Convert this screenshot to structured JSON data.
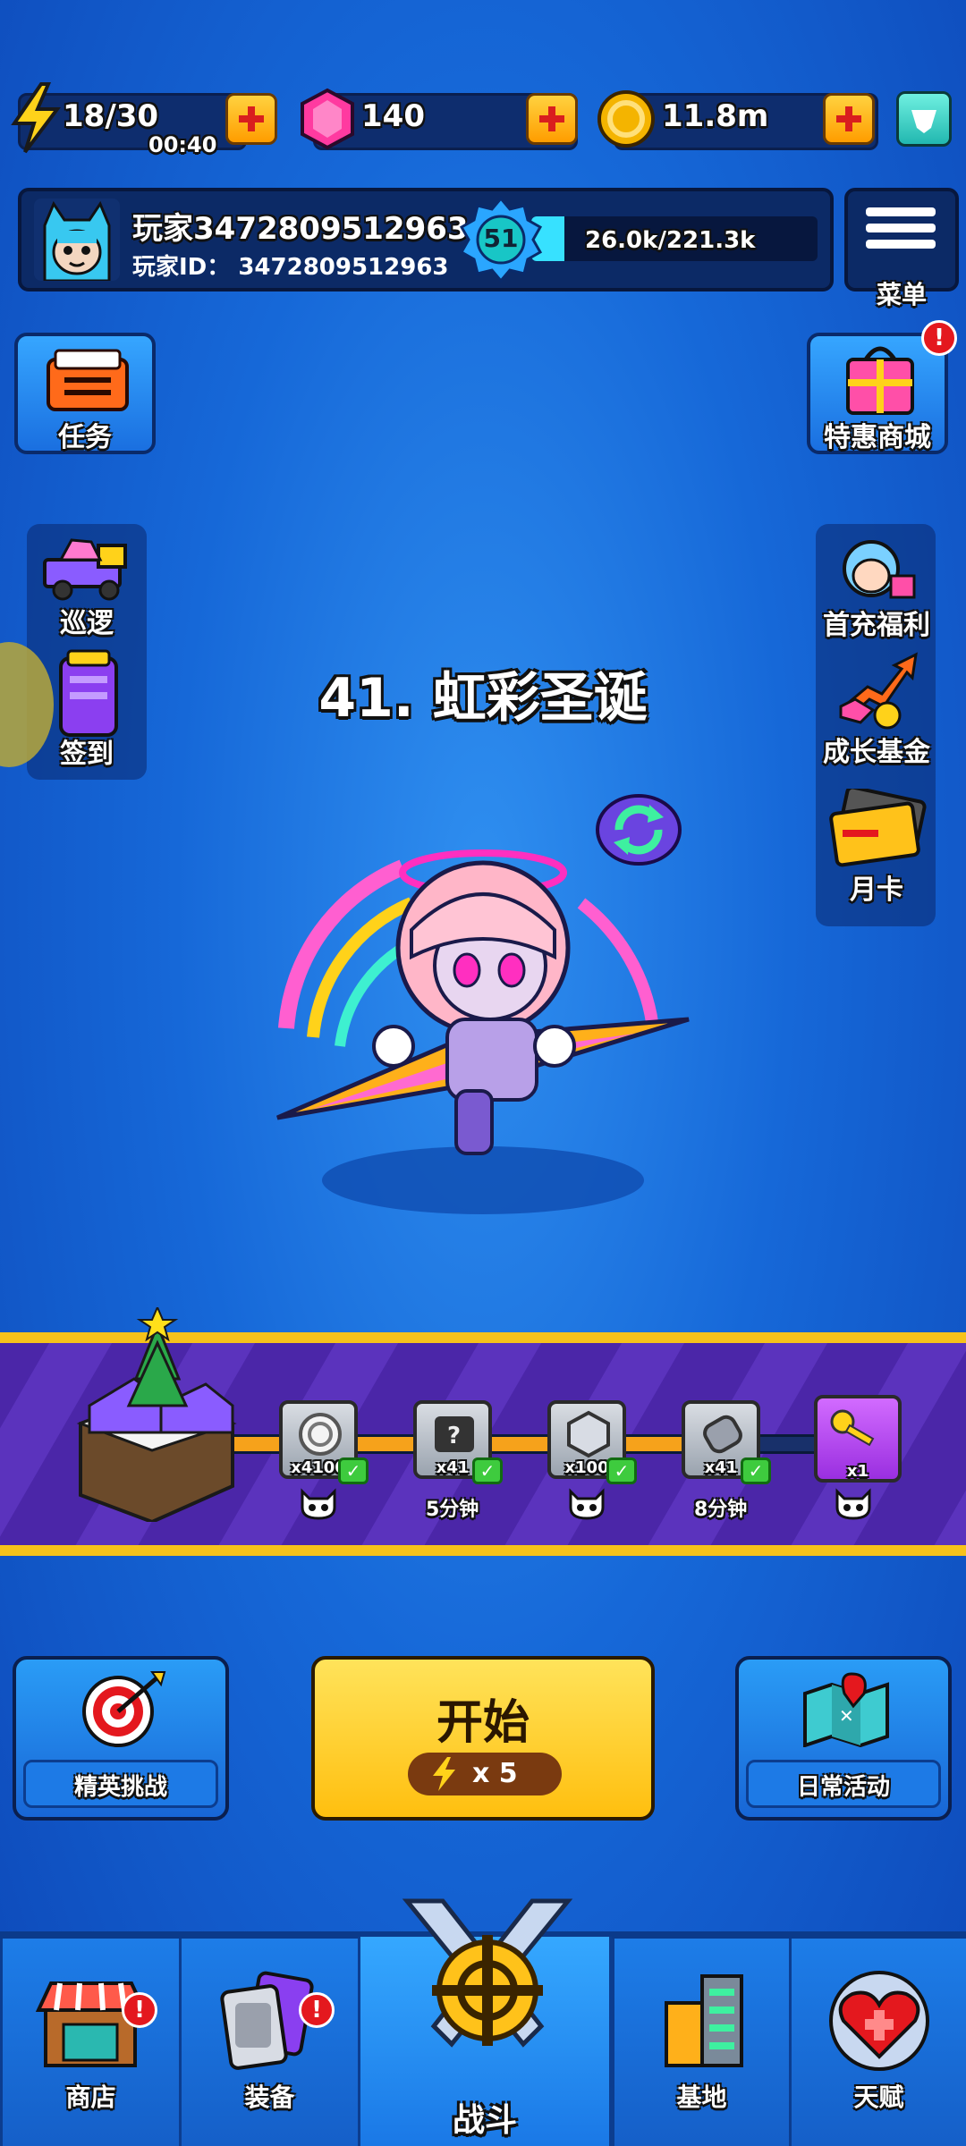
{
  "resources": {
    "energy": "18/30",
    "energy_timer": "00:40",
    "gems": "140",
    "coins": "11.8m"
  },
  "player": {
    "name": "玩家3472809512963",
    "id_label": "玩家ID：",
    "id_value": "3472809512963",
    "level": "51",
    "xp": "26.0k/221.3k",
    "xp_fraction": 0.117
  },
  "menu_label": "菜单",
  "left_buttons": {
    "tasks": "任务",
    "patrol": "巡逻",
    "checkin": "签到"
  },
  "right_buttons": {
    "special_shop": "特惠商城",
    "first_recharge": "首充福利",
    "growth_fund": "成长基金",
    "monthly_card": "月卡"
  },
  "stage": {
    "title": "41. 虹彩圣诞"
  },
  "progress": {
    "nodes": [
      {
        "qty": "x4100",
        "claimed": true,
        "icon": "coin-icon"
      },
      {
        "qty": "x41",
        "claimed": true,
        "icon": "mystery-ticket-icon"
      },
      {
        "qty": "x100",
        "claimed": true,
        "icon": "hexagon-gem-icon"
      },
      {
        "qty": "x41",
        "claimed": true,
        "icon": "chip-icon"
      },
      {
        "qty": "x1",
        "claimed": false,
        "icon": "key-icon"
      }
    ],
    "timers": [
      "5分钟",
      "8分钟"
    ]
  },
  "actions": {
    "elite_challenge": "精英挑战",
    "start": "开始",
    "start_cost": "x 5",
    "daily_events": "日常活动"
  },
  "nav": {
    "shop": "商店",
    "equipment": "装备",
    "battle": "战斗",
    "base": "基地",
    "talent": "天赋"
  },
  "colors": {
    "accent_yellow": "#f6c21b",
    "band_purple": "#4b26a8",
    "badge_red": "#e4181e"
  }
}
